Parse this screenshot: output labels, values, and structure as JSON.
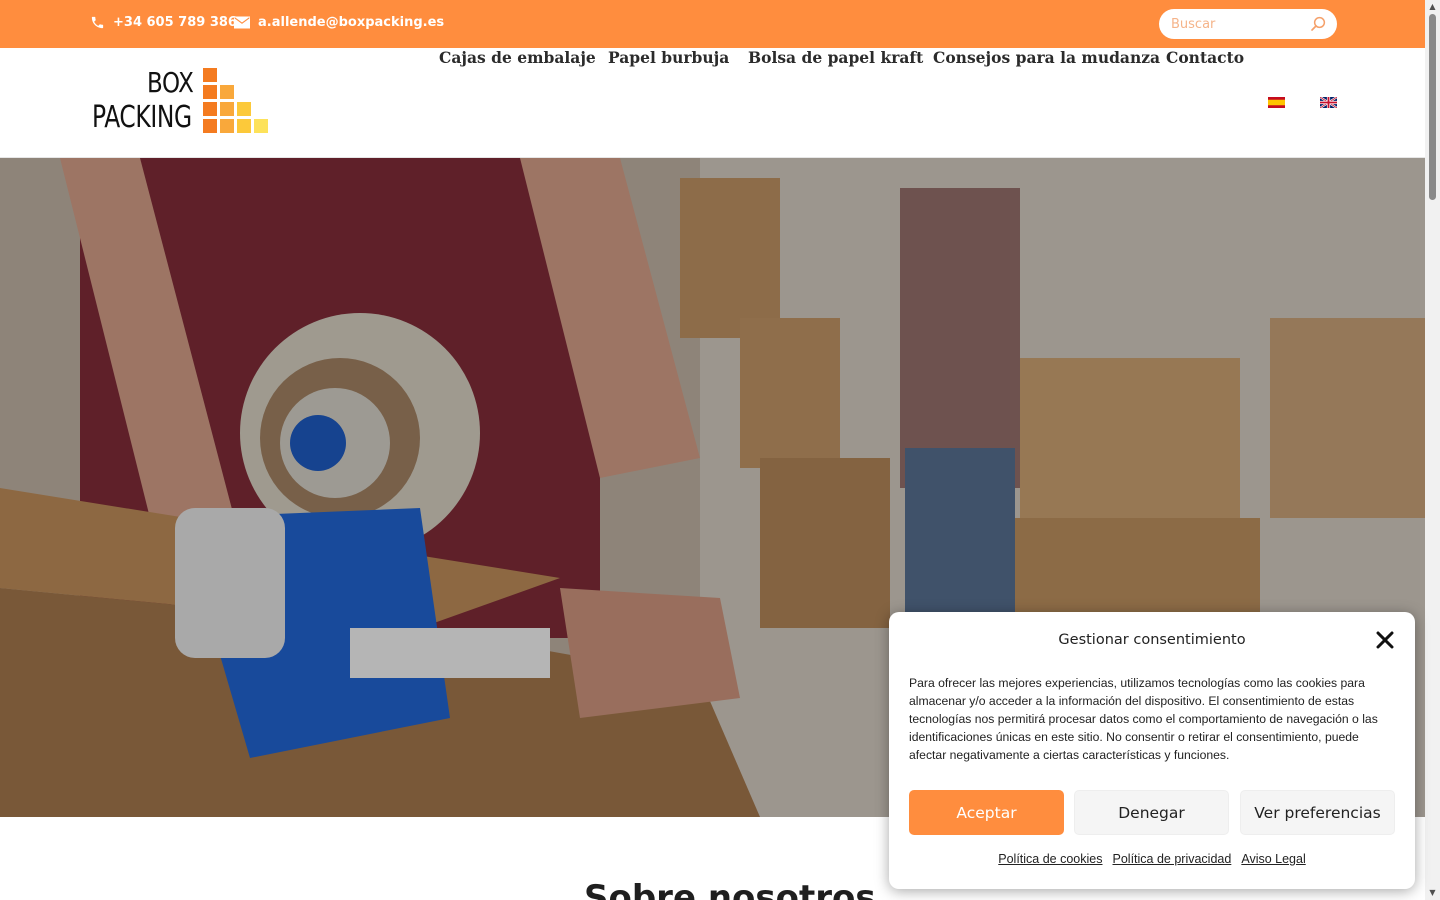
{
  "topbar": {
    "phone": "+34 605 789 386",
    "email": "a.allende@boxpacking.es",
    "search_placeholder": "Buscar",
    "bg_color": "#ff8d3e",
    "icons": [
      "phone-icon",
      "mail-icon",
      "search-icon"
    ]
  },
  "logo": {
    "line1": "BOX",
    "line2": "PACKING",
    "colors": [
      "#f47b20",
      "#f9a83b",
      "#fcc93a",
      "#fde25a"
    ]
  },
  "nav": {
    "items": [
      {
        "label": "Cajas de embalaje"
      },
      {
        "label": "Papel burbuja"
      },
      {
        "label": "Bolsa de papel kraft"
      },
      {
        "label": "Consejos para la mudanza"
      },
      {
        "label": "Contacto"
      }
    ],
    "languages": [
      "flag-spain-icon",
      "flag-uk-icon"
    ]
  },
  "hero": {
    "image": "photo of hands using a blue packing tape dispenser on a cardboard box, with a person and stacked boxes blurred in the background"
  },
  "section": {
    "title": "Sobre nosotros"
  },
  "cookie": {
    "title": "Gestionar consentimiento",
    "text": "Para ofrecer las mejores experiencias, utilizamos tecnologías como las cookies para almacenar y/o acceder a la información del dispositivo. El consentimiento de estas tecnologías nos permitirá procesar datos como el comportamiento de navegación o las identificaciones únicas en este sitio. No consentir o retirar el consentimiento, puede afectar negativamente a ciertas características y funciones.",
    "accept": "Aceptar",
    "deny": "Denegar",
    "preferences": "Ver preferencias",
    "links": {
      "cookies": "Política de cookies",
      "privacy": "Política de privacidad",
      "legal": "Aviso Legal"
    },
    "accent_color": "#ff8d3e"
  }
}
